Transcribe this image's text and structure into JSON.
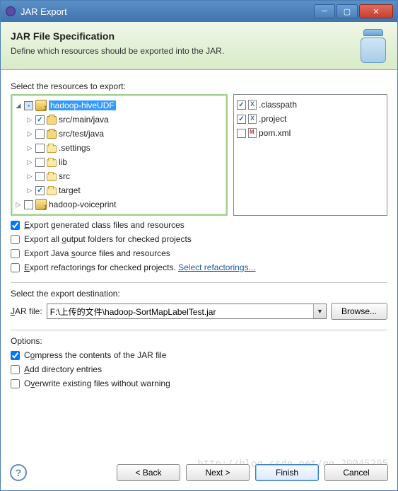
{
  "window": {
    "title": "JAR Export"
  },
  "header": {
    "title": "JAR File Specification",
    "subtitle": "Define which resources should be exported into the JAR."
  },
  "labels": {
    "select_resources": "Select the resources to export:",
    "select_dest": "Select the export destination:",
    "jar_file": "JAR file:",
    "options": "Options:",
    "browse": "Browse...",
    "back": "< Back",
    "next": "Next >",
    "finish": "Finish",
    "cancel": "Cancel",
    "select_refactorings": "Select refactorings..."
  },
  "tree": {
    "root1": "hadoop-hiveUDF",
    "n1": "src/main/java",
    "n2": "src/test/java",
    "n3": ".settings",
    "n4": "lib",
    "n5": "src",
    "n6": "target",
    "root2": "hadoop-voiceprint"
  },
  "files": {
    "f1": ".classpath",
    "f2": ".project",
    "f3": "pom.xml"
  },
  "export_opts": {
    "o1": "Export generated class files and resources",
    "o2": "Export all output folders for checked projects",
    "o3": "Export Java source files and resources",
    "o4": "Export refactorings for checked projects."
  },
  "dest": {
    "value": "F:\\上传的文件\\hadoop-SortMapLabelTest.jar"
  },
  "opts": {
    "c1": "Compress the contents of the JAR file",
    "c2": "Add directory entries",
    "c3": "Overwrite existing files without warning"
  },
  "watermark": "http://blog.csdn.net/qq_20045205"
}
